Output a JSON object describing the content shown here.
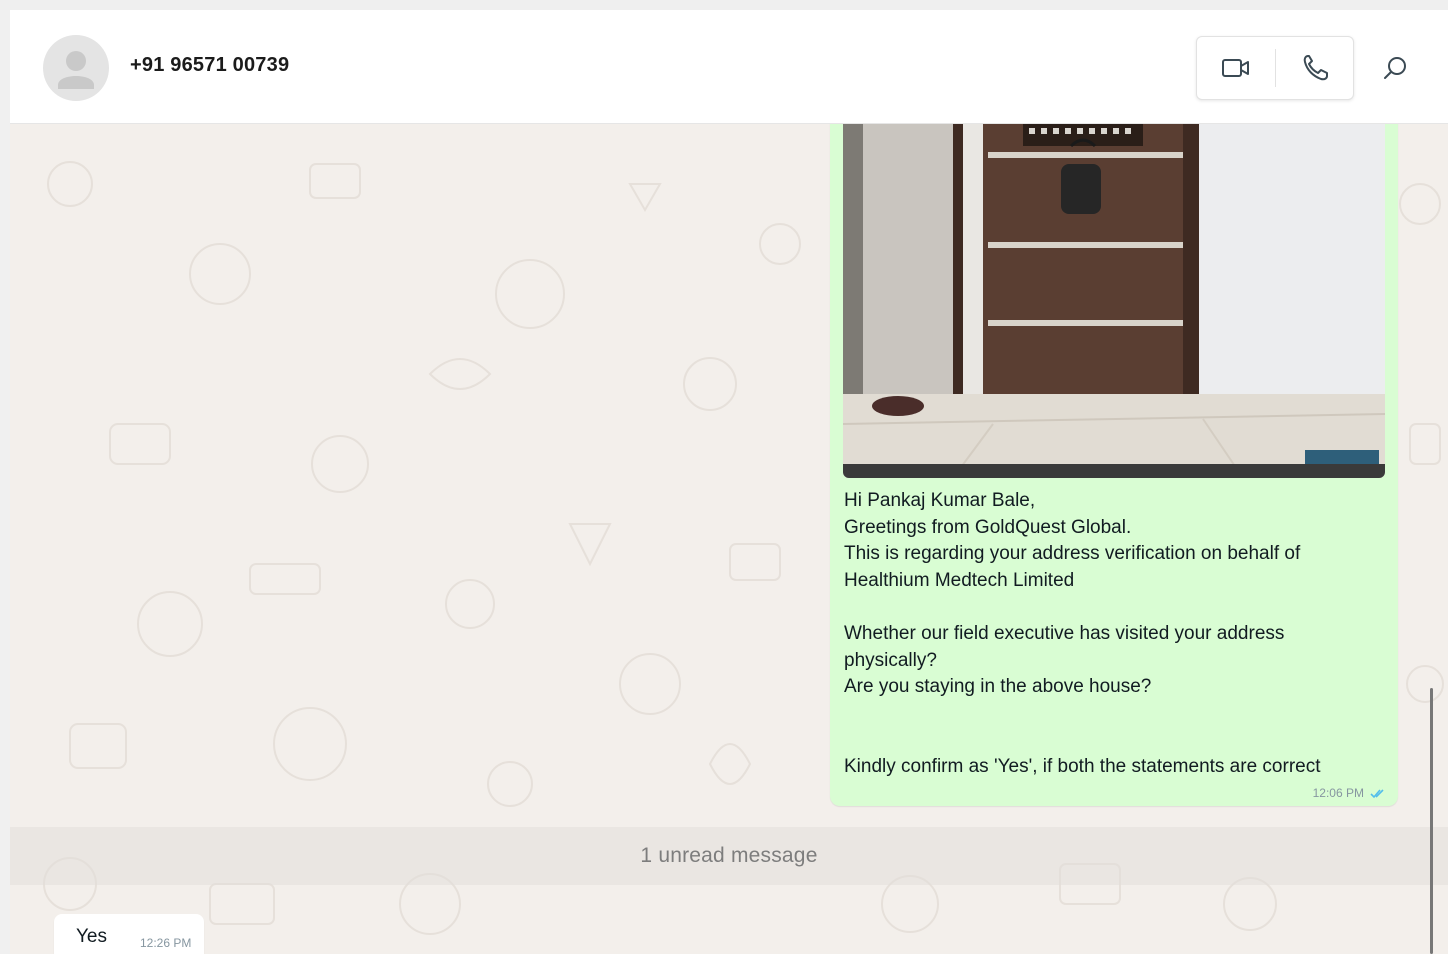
{
  "header": {
    "contact_name": "+91 96571 00739",
    "video_call_icon": "video-camera-icon",
    "voice_call_icon": "phone-icon",
    "search_icon": "search-icon"
  },
  "messages": {
    "outgoing": {
      "photo_description_icon": "door-photo",
      "text": "Hi Pankaj Kumar Bale,\nGreetings from GoldQuest Global.\nThis is regarding your address verification on behalf of\nHealthium Medtech Limited\n\nWhether our field executive has visited your address\nphysically?\nAre you staying in the above house?\n\n\nKindly confirm as 'Yes', if both the statements are correct",
      "time": "12:06 PM",
      "status_icon": "double-check-icon",
      "status_color": "#53bdeb"
    },
    "unread_divider": "1 unread message",
    "incoming": {
      "text": "Yes",
      "time": "12:26 PM"
    }
  },
  "colors": {
    "outgoing_bubble": "#d9fdd3",
    "incoming_bubble": "#ffffff",
    "chat_background": "#f3efeb"
  }
}
